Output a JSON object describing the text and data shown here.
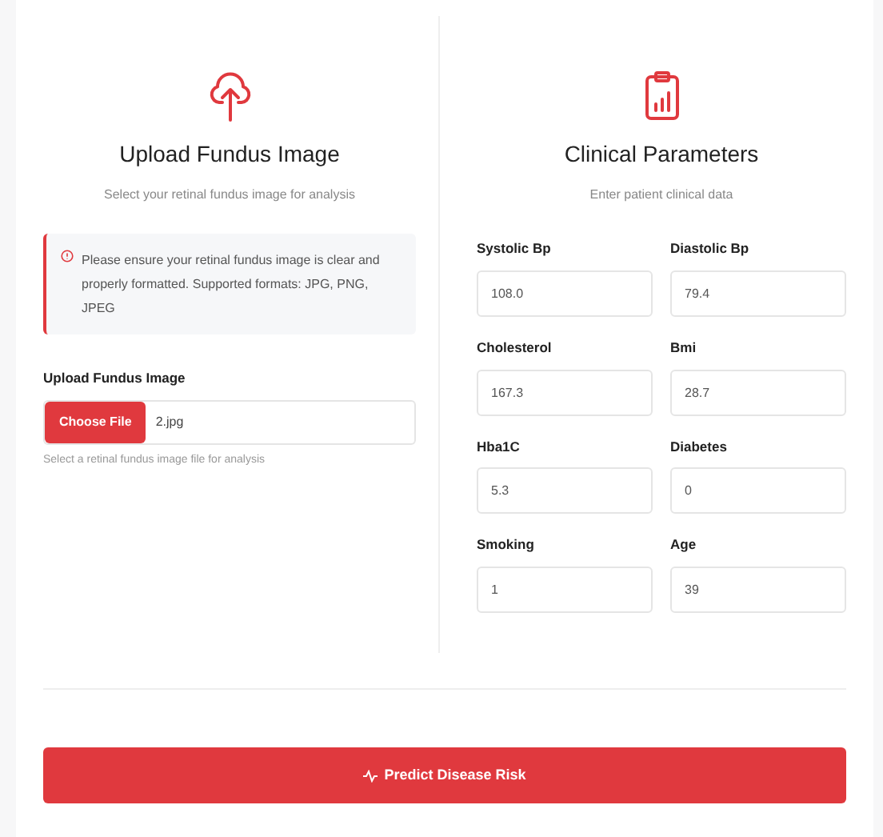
{
  "upload": {
    "title": "Upload Fundus Image",
    "subtitle": "Select your retinal fundus image for analysis",
    "alert": "Please ensure your retinal fundus image is clear and properly formatted. Supported formats: JPG, PNG, JPEG",
    "field_label": "Upload Fundus Image",
    "choose_button": "Choose File",
    "file_name": "2.jpg",
    "help": "Select a retinal fundus image file for analysis"
  },
  "clinical": {
    "title": "Clinical Parameters",
    "subtitle": "Enter patient clinical data",
    "fields": [
      {
        "label": "Systolic Bp",
        "value": "108.0"
      },
      {
        "label": "Diastolic Bp",
        "value": "79.4"
      },
      {
        "label": "Cholesterol",
        "value": "167.3"
      },
      {
        "label": "Bmi",
        "value": "28.7"
      },
      {
        "label": "Hba1C",
        "value": "5.3"
      },
      {
        "label": "Diabetes",
        "value": "0"
      },
      {
        "label": "Smoking",
        "value": "1"
      },
      {
        "label": "Age",
        "value": "39"
      }
    ]
  },
  "predict_button": "Predict Disease Risk"
}
